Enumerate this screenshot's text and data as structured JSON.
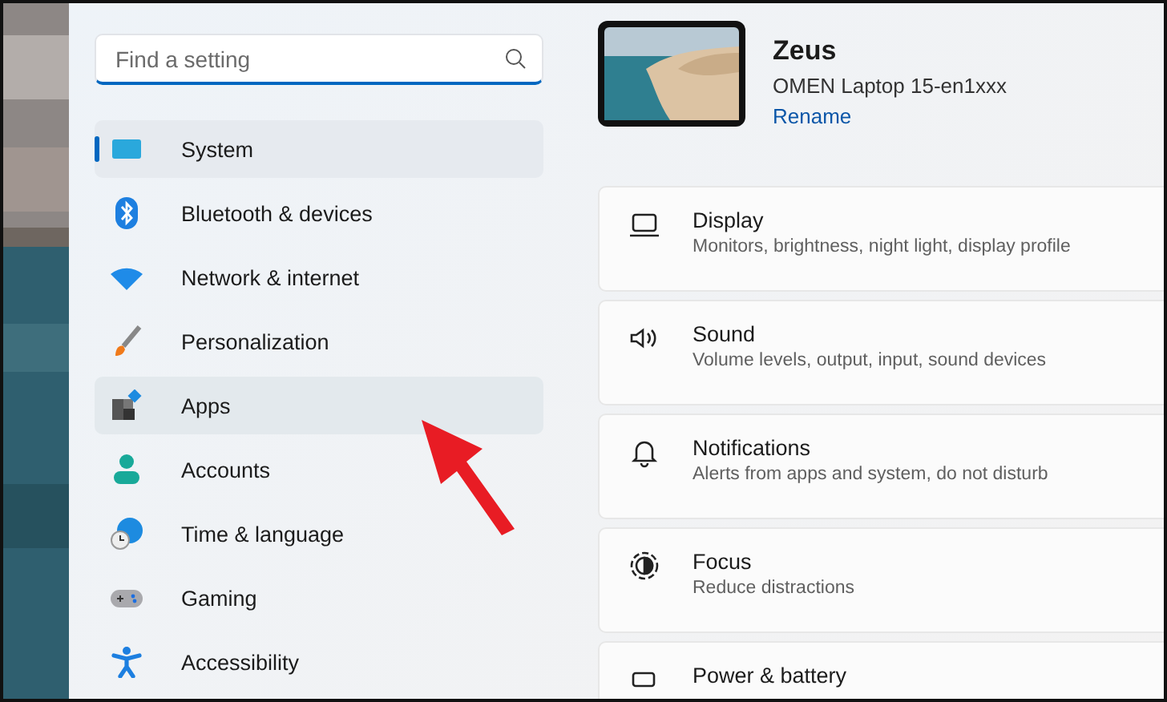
{
  "search": {
    "placeholder": "Find a setting"
  },
  "nav": [
    {
      "label": "System",
      "selected": true,
      "hovered": false
    },
    {
      "label": "Bluetooth & devices",
      "selected": false,
      "hovered": false
    },
    {
      "label": "Network & internet",
      "selected": false,
      "hovered": false
    },
    {
      "label": "Personalization",
      "selected": false,
      "hovered": false
    },
    {
      "label": "Apps",
      "selected": false,
      "hovered": true
    },
    {
      "label": "Accounts",
      "selected": false,
      "hovered": false
    },
    {
      "label": "Time & language",
      "selected": false,
      "hovered": false
    },
    {
      "label": "Gaming",
      "selected": false,
      "hovered": false
    },
    {
      "label": "Accessibility",
      "selected": false,
      "hovered": false
    }
  ],
  "device": {
    "name": "Zeus",
    "model": "OMEN Laptop 15-en1xxx",
    "rename": "Rename"
  },
  "cards": [
    {
      "title": "Display",
      "subtitle": "Monitors, brightness, night light, display profile"
    },
    {
      "title": "Sound",
      "subtitle": "Volume levels, output, input, sound devices"
    },
    {
      "title": "Notifications",
      "subtitle": "Alerts from apps and system, do not disturb"
    },
    {
      "title": "Focus",
      "subtitle": "Reduce distractions"
    },
    {
      "title": "Power & battery"
    }
  ]
}
